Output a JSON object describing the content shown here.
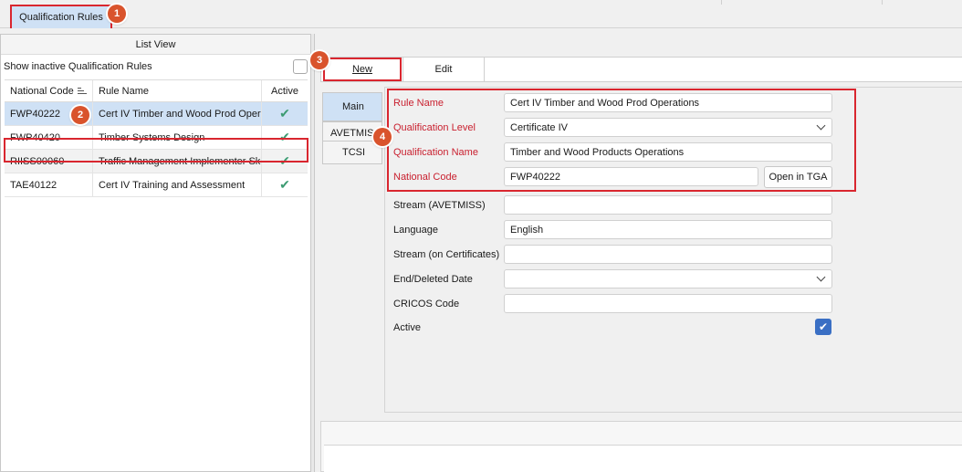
{
  "tabs": {
    "qualification_rules": "Qualification Rules"
  },
  "list_view": {
    "header": "List View",
    "show_inactive_label": "Show inactive Qualification Rules",
    "columns": {
      "national_code": "National Code",
      "rule_name": "Rule Name",
      "active": "Active"
    },
    "rows": [
      {
        "national_code": "FWP40222",
        "rule_name": "Cert IV Timber and Wood Prod Operations",
        "active": "✔"
      },
      {
        "national_code": "FWP40420",
        "rule_name": "Timber Systems Design",
        "active": "✔"
      },
      {
        "national_code": "RIISS00060",
        "rule_name": "Traffic Management Implementer Skill Set",
        "active": "✔"
      },
      {
        "national_code": "TAE40122",
        "rule_name": "Cert IV Training and Assessment",
        "active": "✔"
      }
    ]
  },
  "toolbar": {
    "new_label": "New",
    "edit_label": "Edit"
  },
  "detail_tabs": {
    "main": "Main",
    "avetmiss": "AVETMISS",
    "tcsi": "TCSI"
  },
  "form": {
    "rule_name_label": "Rule Name",
    "rule_name_value": "Cert IV Timber and Wood Prod Operations",
    "qualification_level_label": "Qualification Level",
    "qualification_level_value": "Certificate IV",
    "qualification_name_label": "Qualification Name",
    "qualification_name_value": "Timber and Wood Products Operations",
    "national_code_label": "National Code",
    "national_code_value": "FWP40222",
    "open_tga_label": "Open in TGA",
    "stream_avetmiss_label": "Stream (AVETMISS)",
    "stream_avetmiss_value": "",
    "language_label": "Language",
    "language_value": "English",
    "stream_certificates_label": "Stream (on Certificates)",
    "stream_certificates_value": "",
    "end_deleted_date_label": "End/Deleted Date",
    "end_deleted_date_value": "",
    "cricos_code_label": "CRICOS Code",
    "cricos_code_value": "",
    "active_label": "Active",
    "active_checked": true
  },
  "annotations": [
    "1",
    "2",
    "3",
    "4"
  ],
  "colors": {
    "highlight_red": "#d9262f",
    "badge_orange": "#d9532c",
    "selection_blue": "#cfe1f5",
    "required_label": "#c9202f",
    "checkbox_blue": "#3a6fc4"
  }
}
